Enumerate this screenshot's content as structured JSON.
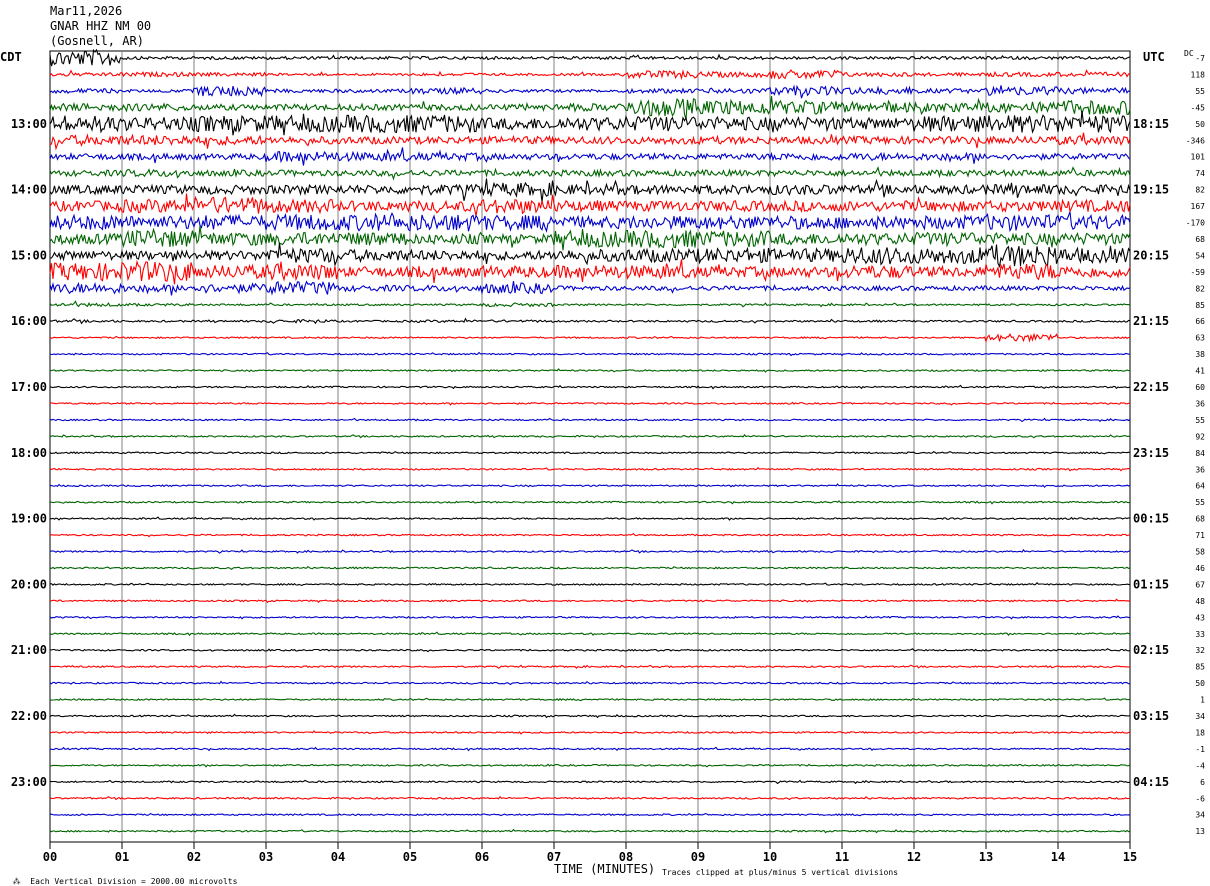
{
  "header": {
    "date": "Mar11,2026",
    "station": "GNAR HHZ NM 00",
    "location": "(Gosnell, AR)"
  },
  "left_zone": "CDT",
  "right_zone": "UTC",
  "dc_header": "DC",
  "x_axis_title": "TIME (MINUTES)",
  "footer_left": "Each Vertical Division = 2000.00 microvolts",
  "footer_right": "Traces clipped at plus/minus 5 vertical divisions",
  "colors": {
    "black": "#000000",
    "red": "#ff0000",
    "blue": "#0000cc",
    "green": "#006400",
    "grid": "#808080"
  },
  "chart_data": {
    "type": "line",
    "title": "GNAR HHZ NM 00",
    "xlabel": "TIME (MINUTES)",
    "xlim": [
      0,
      15
    ],
    "x_ticks": [
      "00",
      "01",
      "02",
      "03",
      "04",
      "05",
      "06",
      "07",
      "08",
      "09",
      "10",
      "11",
      "12",
      "13",
      "14",
      "15"
    ],
    "left_hour_labels": [
      "13:00",
      "14:00",
      "15:00",
      "16:00",
      "17:00",
      "18:00",
      "19:00",
      "20:00",
      "21:00",
      "22:00",
      "23:00"
    ],
    "right_hour_labels": [
      "18:15",
      "19:15",
      "20:15",
      "21:15",
      "22:15",
      "23:15",
      "00:15",
      "01:15",
      "02:15",
      "03:15",
      "04:15"
    ],
    "trace_color_cycle": [
      "black",
      "red",
      "blue",
      "green"
    ],
    "dc_offsets": [
      "-7",
      "118",
      "55",
      "-45",
      "50",
      "-346",
      "101",
      "74",
      "82",
      "167",
      "-170",
      "68",
      "54",
      "-59",
      "82",
      "85",
      "66",
      "63",
      "38",
      "41",
      "60",
      "36",
      "55",
      "92",
      "84",
      "36",
      "64",
      "55",
      "68",
      "71",
      "58",
      "46",
      "67",
      "48",
      "43",
      "33",
      "32",
      "85",
      "50",
      "1",
      "34",
      "18",
      "-1",
      "-4",
      "6",
      "-6",
      "34",
      "13"
    ],
    "activity": [
      [
        0.55,
        0.1,
        0.1,
        0.1,
        0.1,
        0.1,
        0.1,
        0.1,
        0.1,
        0.1,
        0.1,
        0.1,
        0.1,
        0.1,
        0.1
      ],
      [
        0.12,
        0.15,
        0.12,
        0.08,
        0.08,
        0.1,
        0.08,
        0.08,
        0.25,
        0.18,
        0.3,
        0.15,
        0.12,
        0.15,
        0.15
      ],
      [
        0.15,
        0.1,
        0.35,
        0.12,
        0.12,
        0.2,
        0.1,
        0.1,
        0.15,
        0.18,
        0.3,
        0.25,
        0.15,
        0.3,
        0.2
      ],
      [
        0.25,
        0.25,
        0.2,
        0.2,
        0.2,
        0.2,
        0.2,
        0.25,
        0.6,
        0.5,
        0.45,
        0.35,
        0.3,
        0.35,
        0.5
      ],
      [
        0.55,
        0.45,
        0.55,
        0.55,
        0.6,
        0.6,
        0.4,
        0.45,
        0.5,
        0.45,
        0.45,
        0.4,
        0.55,
        0.6,
        0.6
      ],
      [
        0.35,
        0.35,
        0.3,
        0.25,
        0.25,
        0.25,
        0.25,
        0.25,
        0.25,
        0.25,
        0.25,
        0.25,
        0.25,
        0.25,
        0.3
      ],
      [
        0.2,
        0.2,
        0.2,
        0.35,
        0.3,
        0.25,
        0.2,
        0.2,
        0.2,
        0.2,
        0.25,
        0.25,
        0.25,
        0.2,
        0.2
      ],
      [
        0.2,
        0.25,
        0.2,
        0.2,
        0.2,
        0.2,
        0.2,
        0.2,
        0.2,
        0.2,
        0.2,
        0.2,
        0.2,
        0.2,
        0.2
      ],
      [
        0.3,
        0.3,
        0.3,
        0.3,
        0.3,
        0.35,
        0.45,
        0.35,
        0.3,
        0.3,
        0.35,
        0.3,
        0.3,
        0.35,
        0.3
      ],
      [
        0.35,
        0.45,
        0.6,
        0.45,
        0.35,
        0.35,
        0.5,
        0.35,
        0.35,
        0.35,
        0.35,
        0.35,
        0.35,
        0.35,
        0.4
      ],
      [
        0.5,
        0.45,
        0.5,
        0.55,
        0.55,
        0.6,
        0.5,
        0.4,
        0.45,
        0.45,
        0.45,
        0.4,
        0.45,
        0.55,
        0.5
      ],
      [
        0.35,
        0.6,
        0.45,
        0.45,
        0.45,
        0.35,
        0.3,
        0.55,
        0.6,
        0.55,
        0.4,
        0.4,
        0.45,
        0.4,
        0.4
      ],
      [
        0.3,
        0.3,
        0.3,
        0.5,
        0.4,
        0.35,
        0.3,
        0.4,
        0.45,
        0.5,
        0.45,
        0.6,
        0.55,
        0.75,
        0.5
      ],
      [
        0.6,
        0.7,
        0.45,
        0.55,
        0.35,
        0.35,
        0.4,
        0.45,
        0.45,
        0.35,
        0.35,
        0.45,
        0.35,
        0.55,
        0.4
      ],
      [
        0.35,
        0.25,
        0.3,
        0.45,
        0.2,
        0.2,
        0.35,
        0.15,
        0.15,
        0.15,
        0.15,
        0.15,
        0.15,
        0.15,
        0.15
      ],
      [
        0.12,
        0.08,
        0.06,
        0.06,
        0.06,
        0.06,
        0.12,
        0.06,
        0.06,
        0.06,
        0.06,
        0.06,
        0.06,
        0.06,
        0.06
      ],
      [
        0.08,
        0.06,
        0.06,
        0.1,
        0.06,
        0.08,
        0.08,
        0.06,
        0.06,
        0.06,
        0.06,
        0.06,
        0.06,
        0.06,
        0.06
      ],
      [
        0.05,
        0.05,
        0.05,
        0.05,
        0.05,
        0.05,
        0.05,
        0.05,
        0.05,
        0.05,
        0.05,
        0.05,
        0.05,
        0.25,
        0.05
      ]
    ],
    "quiet_amplitude": 0.05
  }
}
